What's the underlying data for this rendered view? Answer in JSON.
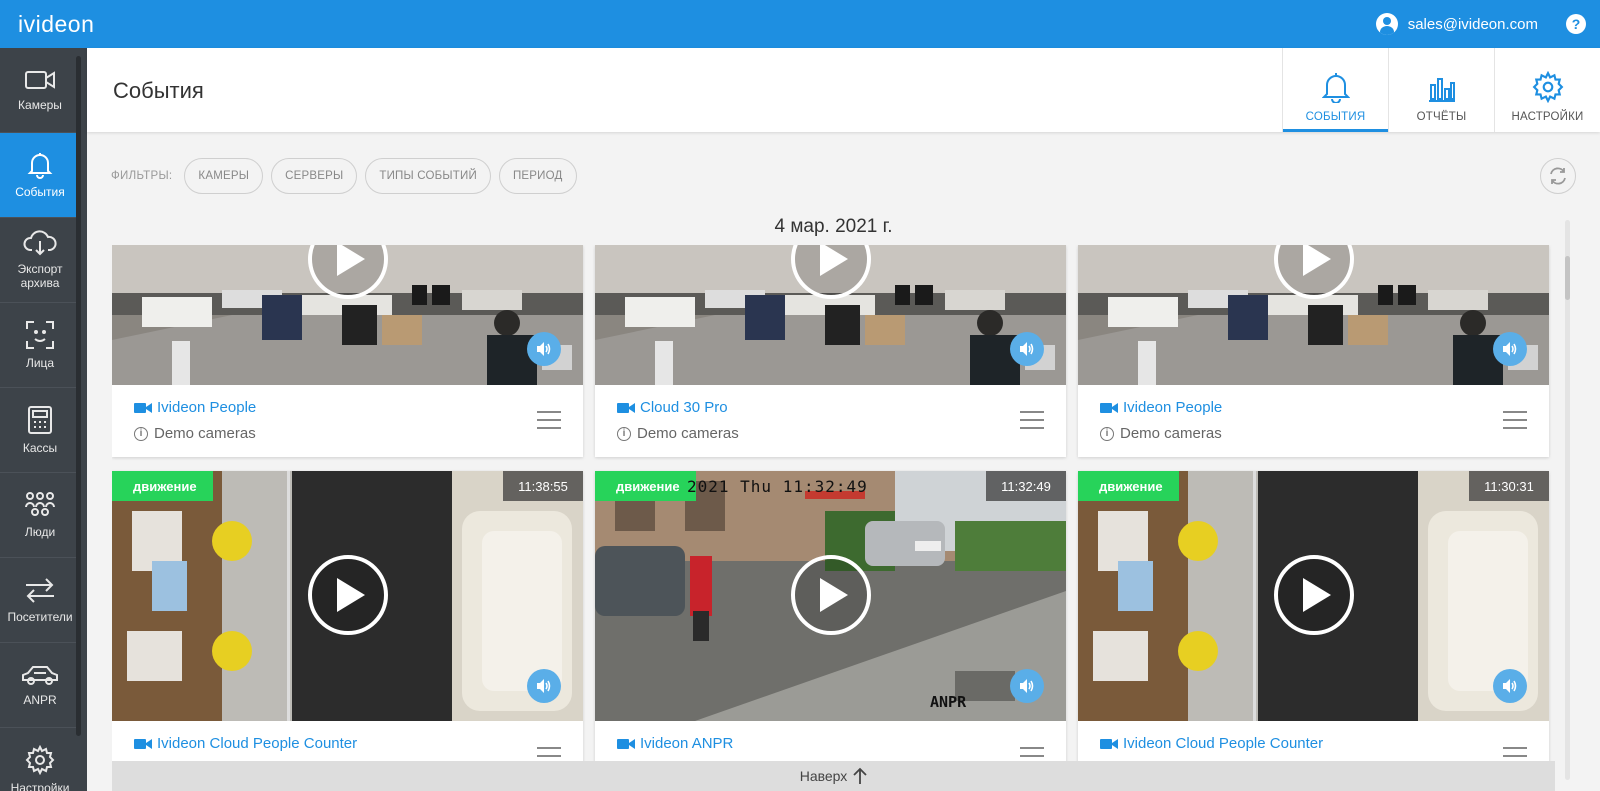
{
  "app": {
    "logo": "ivideon"
  },
  "account": {
    "email": "sales@ivideon.com",
    "help": "?"
  },
  "sidebar": {
    "items": [
      {
        "label": "Камеры",
        "icon": "camera-icon",
        "active": false
      },
      {
        "label": "События",
        "icon": "bell-icon",
        "active": true
      },
      {
        "label": "Экспорт архива",
        "icon": "cloud-download-icon",
        "active": false
      },
      {
        "label": "Лица",
        "icon": "face-scan-icon",
        "active": false
      },
      {
        "label": "Кассы",
        "icon": "cash-register-icon",
        "active": false
      },
      {
        "label": "Люди",
        "icon": "people-icon",
        "active": false
      },
      {
        "label": "Посетители",
        "icon": "visitors-arrows-icon",
        "active": false
      },
      {
        "label": "ANPR",
        "icon": "car-icon",
        "active": false
      },
      {
        "label": "Настройки",
        "icon": "gear-icon",
        "active": false
      }
    ]
  },
  "header": {
    "title": "События",
    "tabs": [
      {
        "label": "СОБЫТИЯ",
        "icon": "bell-icon",
        "active": true
      },
      {
        "label": "ОТЧЁТЫ",
        "icon": "bar-chart-icon",
        "active": false
      },
      {
        "label": "НАСТРОЙКИ",
        "icon": "gear-icon",
        "active": false
      }
    ]
  },
  "filters": {
    "label": "ФИЛЬТРЫ:",
    "chips": [
      "КАМЕРЫ",
      "СЕРВЕРЫ",
      "ТИПЫ СОБЫТИЙ",
      "ПЕРИОД"
    ]
  },
  "date_heading": "4 мар. 2021 г.",
  "events": [
    {
      "camera": "Ivideon People",
      "group": "Demo cameras",
      "badge": "",
      "time": "",
      "scene": "office"
    },
    {
      "camera": "Cloud 30 Pro",
      "group": "Demo cameras",
      "badge": "",
      "time": "",
      "scene": "office"
    },
    {
      "camera": "Ivideon People",
      "group": "Demo cameras",
      "badge": "",
      "time": "",
      "scene": "office"
    },
    {
      "camera": "Ivideon Cloud People Counter",
      "group": "",
      "badge": "движение",
      "time": "11:38:55",
      "scene": "lobby"
    },
    {
      "camera": "Ivideon ANPR",
      "group": "",
      "badge": "движение",
      "time": "11:32:49",
      "scene": "street"
    },
    {
      "camera": "Ivideon Cloud People Counter",
      "group": "",
      "badge": "движение",
      "time": "11:30:31",
      "scene": "lobby"
    }
  ],
  "street_overlay": {
    "timestamp": "2021 Thu 11:32:49",
    "watermark": "ANPR"
  },
  "scroll_top": {
    "label": "Наверх"
  },
  "colors": {
    "brand": "#1e8fe1",
    "sidebar": "#3d4349",
    "motion_badge": "#27d35a"
  }
}
